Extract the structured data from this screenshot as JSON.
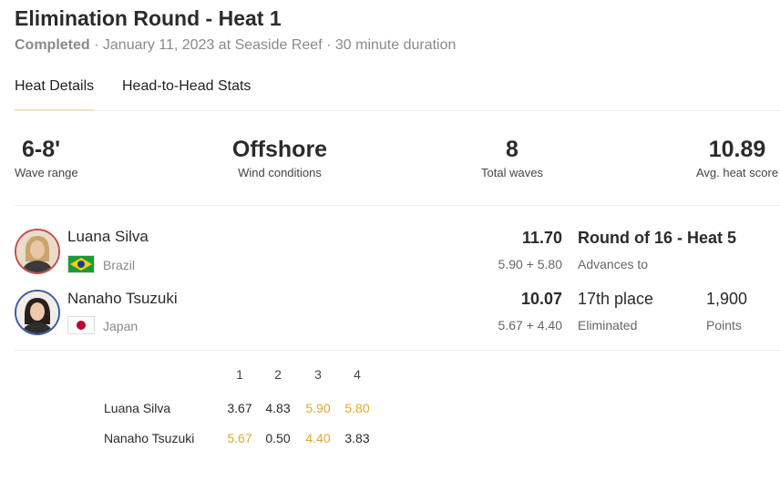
{
  "heat": {
    "title": "Elimination Round - Heat 1",
    "status": "Completed",
    "details": " · January 11, 2023 at Seaside Reef · 30 minute duration"
  },
  "tabs": [
    {
      "label": "Heat Details",
      "active": true
    },
    {
      "label": "Head-to-Head Stats",
      "active": false
    }
  ],
  "stats": {
    "wave_range": {
      "value": "6-8'",
      "label": "Wave range"
    },
    "wind": {
      "value": "Offshore",
      "label": "Wind conditions"
    },
    "waves": {
      "value": "8",
      "label": "Total waves"
    },
    "avg": {
      "value": "10.89",
      "label": "Avg. heat score"
    }
  },
  "surfers": [
    {
      "name": "Luana Silva",
      "country": "Brazil",
      "flag_icon": "brazil-flag-icon",
      "total": "11.70",
      "breakdown": "5.90 + 5.80",
      "result": "Round of 16 - Heat 5",
      "result_label": "Advances to",
      "ring_color": "#c0504d"
    },
    {
      "name": "Nanaho Tsuzuki",
      "country": "Japan",
      "flag_icon": "japan-flag-icon",
      "total": "10.07",
      "breakdown": "5.67 + 4.40",
      "result": "17th place",
      "result_label": "Eliminated",
      "points": "1,900",
      "points_label": "Points",
      "ring_color": "#3b5aa8"
    }
  ],
  "waves": {
    "headers": [
      "1",
      "2",
      "3",
      "4"
    ],
    "rows": [
      {
        "name": "Luana Silva",
        "scores": [
          "3.67",
          "4.83",
          "5.90",
          "5.80"
        ],
        "counting": [
          false,
          false,
          true,
          true
        ]
      },
      {
        "name": "Nanaho Tsuzuki",
        "scores": [
          "5.67",
          "0.50",
          "4.40",
          "3.83"
        ],
        "counting": [
          true,
          false,
          true,
          false
        ]
      }
    ]
  },
  "colors": {
    "counting_score": "#e0a82e",
    "tab_underline": "#f2d99a"
  }
}
